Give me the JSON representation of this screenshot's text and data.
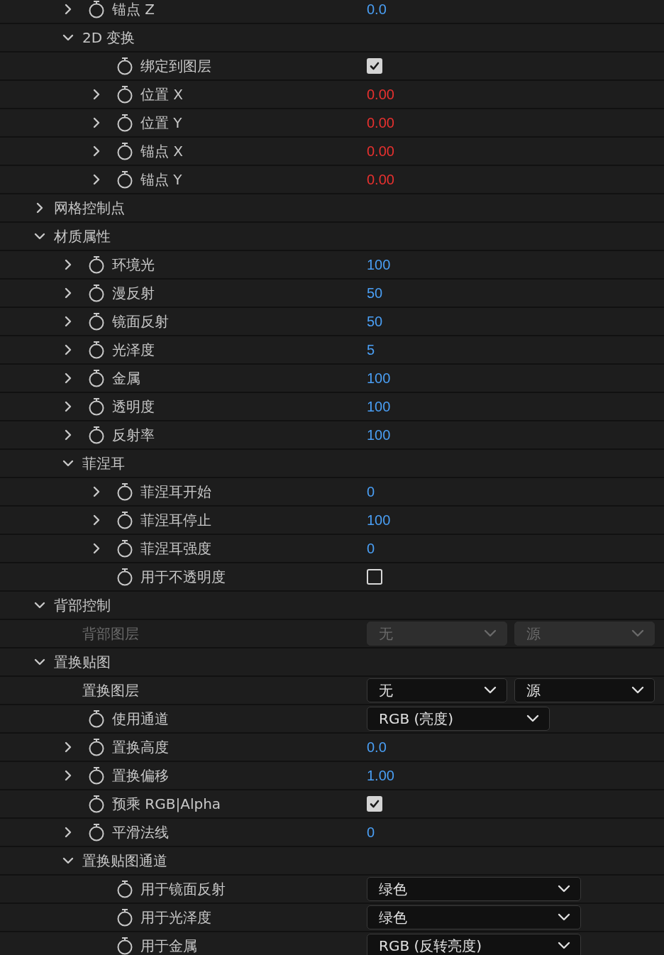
{
  "continued_items": [
    {
      "label": "锚点 Z",
      "expanded": false,
      "stopwatch": true,
      "kind": "number",
      "value": "0.0",
      "color": "#4a9ff5"
    },
    {
      "label": "2D 变换",
      "expanded": true,
      "stopwatch": false,
      "children": [
        {
          "label": "绑定到图层",
          "stopwatch": true,
          "kind": "checkbox",
          "checked": true
        },
        {
          "label": "位置 X",
          "expanded": false,
          "stopwatch": true,
          "kind": "number",
          "value": "0.00",
          "color": "#e8312f"
        },
        {
          "label": "位置 Y",
          "expanded": false,
          "stopwatch": true,
          "kind": "number",
          "value": "0.00",
          "color": "#e8312f"
        },
        {
          "label": "锚点 X",
          "expanded": false,
          "stopwatch": true,
          "kind": "number",
          "value": "0.00",
          "color": "#e8312f"
        },
        {
          "label": "锚点 Y",
          "expanded": false,
          "stopwatch": true,
          "kind": "number",
          "value": "0.00",
          "color": "#e8312f"
        }
      ]
    }
  ],
  "tree": [
    {
      "label": "网格控制点",
      "expanded": false,
      "stopwatch": false
    },
    {
      "label": "材质属性",
      "expanded": true,
      "stopwatch": false,
      "children": [
        {
          "label": "环境光",
          "expanded": false,
          "stopwatch": true,
          "kind": "number",
          "value": "100",
          "color": "#4a9ff5"
        },
        {
          "label": "漫反射",
          "expanded": false,
          "stopwatch": true,
          "kind": "number",
          "value": "50",
          "color": "#4a9ff5"
        },
        {
          "label": "镜面反射",
          "expanded": false,
          "stopwatch": true,
          "kind": "number",
          "value": "50",
          "color": "#4a9ff5"
        },
        {
          "label": "光泽度",
          "expanded": false,
          "stopwatch": true,
          "kind": "number",
          "value": "5",
          "color": "#4a9ff5"
        },
        {
          "label": "金属",
          "expanded": false,
          "stopwatch": true,
          "kind": "number",
          "value": "100",
          "color": "#4a9ff5"
        },
        {
          "label": "透明度",
          "expanded": false,
          "stopwatch": true,
          "kind": "number",
          "value": "100",
          "color": "#4a9ff5"
        },
        {
          "label": "反射率",
          "expanded": false,
          "stopwatch": true,
          "kind": "number",
          "value": "100",
          "color": "#4a9ff5"
        },
        {
          "label": "菲涅耳",
          "expanded": true,
          "stopwatch": false,
          "children": [
            {
              "label": "菲涅耳开始",
              "expanded": false,
              "stopwatch": true,
              "kind": "number",
              "value": "0",
              "color": "#4a9ff5"
            },
            {
              "label": "菲涅耳停止",
              "expanded": false,
              "stopwatch": true,
              "kind": "number",
              "value": "100",
              "color": "#4a9ff5"
            },
            {
              "label": "菲涅耳强度",
              "expanded": false,
              "stopwatch": true,
              "kind": "number",
              "value": "0",
              "color": "#4a9ff5"
            },
            {
              "label": "用于不透明度",
              "stopwatch": true,
              "kind": "checkbox",
              "checked": false
            }
          ]
        }
      ]
    },
    {
      "label": "背部控制",
      "expanded": true,
      "stopwatch": false,
      "children": [
        {
          "label": "背部图层",
          "stopwatch": false,
          "kind": "dropdowns",
          "disabled": true,
          "dropdowns": [
            {
              "value": "无"
            },
            {
              "value": "源"
            }
          ]
        }
      ]
    },
    {
      "label": "置换贴图",
      "expanded": true,
      "stopwatch": false,
      "children": [
        {
          "label": "置换图层",
          "stopwatch": false,
          "kind": "dropdowns",
          "disabled": false,
          "dropdowns": [
            {
              "value": "无"
            },
            {
              "value": "源"
            }
          ]
        },
        {
          "label": "使用通道",
          "stopwatch": true,
          "kind": "dropdown",
          "disabled": false,
          "value": "RGB (亮度)"
        },
        {
          "label": "置换高度",
          "expanded": false,
          "stopwatch": true,
          "kind": "number",
          "value": "0.0",
          "color": "#4a9ff5"
        },
        {
          "label": "置换偏移",
          "expanded": false,
          "stopwatch": true,
          "kind": "number",
          "value": "1.00",
          "color": "#4a9ff5"
        },
        {
          "label": "预乘 RGB|Alpha",
          "stopwatch": true,
          "kind": "checkbox",
          "checked": true
        },
        {
          "label": "平滑法线",
          "expanded": false,
          "stopwatch": true,
          "kind": "number",
          "value": "0",
          "color": "#4a9ff5"
        },
        {
          "label": "置换贴图通道",
          "expanded": true,
          "stopwatch": false,
          "children": [
            {
              "label": "用于镜面反射",
              "stopwatch": true,
              "kind": "dropdown",
              "disabled": false,
              "value": "绿色"
            },
            {
              "label": "用于光泽度",
              "stopwatch": true,
              "kind": "dropdown",
              "disabled": false,
              "value": "绿色"
            },
            {
              "label": "用于金属",
              "stopwatch": true,
              "kind": "dropdown",
              "disabled": false,
              "value": "RGB (反转亮度)"
            }
          ]
        }
      ]
    }
  ]
}
